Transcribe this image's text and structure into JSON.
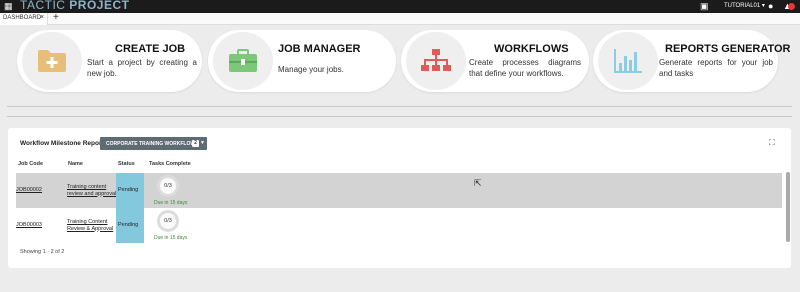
{
  "app": {
    "logo_light": "TACTIC ",
    "logo_bold": "PROJECT",
    "user": "TUTORIAL01 ▾"
  },
  "tabs": [
    {
      "label": "DASHBOARD",
      "close": "×"
    }
  ],
  "new_tab": "+",
  "cards": {
    "create_job": {
      "title": "CREATE JOB",
      "desc": "Start a project by creating a new job."
    },
    "job_manager": {
      "title": "JOB MANAGER",
      "desc": "Manage your jobs."
    },
    "workflows": {
      "title": "WORKFLOWS",
      "desc": "Create processes diagrams that define your workflows."
    },
    "reports": {
      "title": "REPORTS GENERATOR",
      "desc": "Generate reports for your job and tasks"
    }
  },
  "report": {
    "title": "Workflow Milestone Report:",
    "dropdown_label": "CORPORATE TRAINING WORKFLOW",
    "dropdown_badge": "2",
    "columns": [
      "Job Code",
      "Name",
      "Status",
      "Tasks Complete"
    ],
    "rows": [
      {
        "code": "JOB00002",
        "name": "Training content review and approval",
        "status": "Pending",
        "tasks": "0/3",
        "due": "Due in 15 days"
      },
      {
        "code": "JOB00003",
        "name": "Training Content Review & Approval",
        "status": "Pending",
        "tasks": "0/3",
        "due": "Due in 15 days"
      }
    ],
    "footer": "Showing  1 - 2  of  2"
  },
  "colors": {
    "topbar": "#1b1b1b",
    "logo": "#8fb4ca",
    "status_pending": "#84c8dd",
    "selected_row": "#d3d3d3",
    "dropdown": "#5f6b72",
    "due_text": "#3a8a3a"
  },
  "icons": {
    "create_job": "folder-plus-icon",
    "job_manager": "briefcase-icon",
    "workflows": "sitemap-icon",
    "reports": "bar-chart-icon"
  }
}
